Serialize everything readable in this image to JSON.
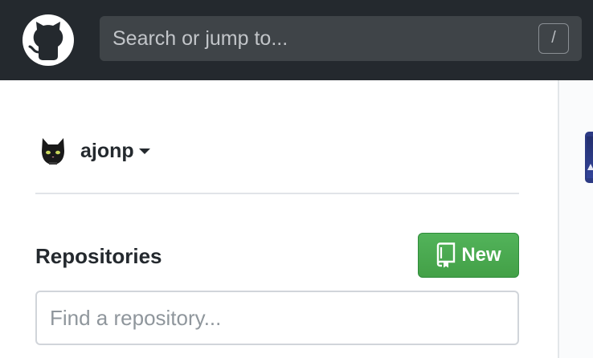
{
  "header": {
    "logo_icon": "github-octocat-icon",
    "search_placeholder": "Search or jump to...",
    "search_shortcut": "/"
  },
  "sidebar": {
    "account": {
      "avatar_icon": "black-cat-avatar",
      "username": "ajonp",
      "dropdown_icon": "caret-down-icon"
    },
    "repositories": {
      "title": "Repositories",
      "new_button_label": "New",
      "new_button_icon": "repo-book-icon",
      "find_placeholder": "Find a repository..."
    }
  },
  "colors": {
    "header_bg": "#24292e",
    "new_button_green": "#4cae54"
  }
}
